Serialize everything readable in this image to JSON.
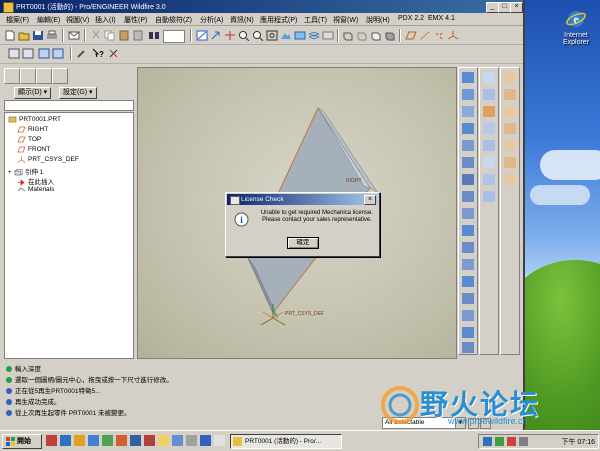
{
  "window": {
    "title": "PRT0001 (活動的) - Pro/ENGINEER Wildfire 3.0"
  },
  "menu": [
    "檔案(F)",
    "編輯(E)",
    "視圖(V)",
    "插入(I)",
    "屬性(P)",
    "自動檢符(Z)",
    "分析(A)",
    "資訊(N)",
    "應用程式(P)",
    "工具(T)",
    "視窗(W)",
    "說明(H)",
    "PDX 2.2",
    "EMX 4.1"
  ],
  "left_panel": {
    "display_button": "顯示(D) ▾",
    "settings_button": "設定(G) ▾",
    "tree": [
      {
        "label": "PRT0001.PRT",
        "icon": "part-icon"
      },
      {
        "label": "RIGHT",
        "icon": "datum-plane-icon"
      },
      {
        "label": "TOP",
        "icon": "datum-plane-icon"
      },
      {
        "label": "FRONT",
        "icon": "datum-plane-icon"
      },
      {
        "label": "PRT_CSYS_DEF",
        "icon": "csys-icon"
      },
      {
        "label": "引伸 1",
        "icon": "extrude-icon"
      },
      {
        "label": "在此插入",
        "icon": "insert-arrow-icon"
      },
      {
        "label": "Materials",
        "icon": "materials-icon"
      }
    ]
  },
  "graphics": {
    "csys_label": "PRT_CSYS_DEF",
    "view_label": "RIGHT"
  },
  "dialog": {
    "title": "License Check",
    "message_line1": "Unable to get required Mechanica license.",
    "message_line2": "Please contact your sales representative.",
    "ok_label": "確定"
  },
  "messages": [
    "輸入深度",
    "選取一個圖柄/圖元中心，拖曳或按一下尺寸進行修改。",
    "正在從5再生PRT0001特徵5...",
    "再生成功完成。",
    "從上次再生起零件 PRT0001 未被變更。"
  ],
  "status": {
    "filter_value": "All Selectable"
  },
  "taskbar": {
    "start_label": "開始",
    "task_label": "PRT0001 (活動的) - Pro/...",
    "clock": "下午 07:16"
  },
  "desktop": {
    "icon_label": "Internet Explorer"
  },
  "watermark": {
    "text": "野火论坛",
    "url": "www.proewildfire.cn"
  },
  "colors": {
    "titlebar": "#0a246a",
    "graphics_bg": "#c4c1ae",
    "model_face": "#a9b3bd",
    "watermark": "#2a8fd0"
  }
}
